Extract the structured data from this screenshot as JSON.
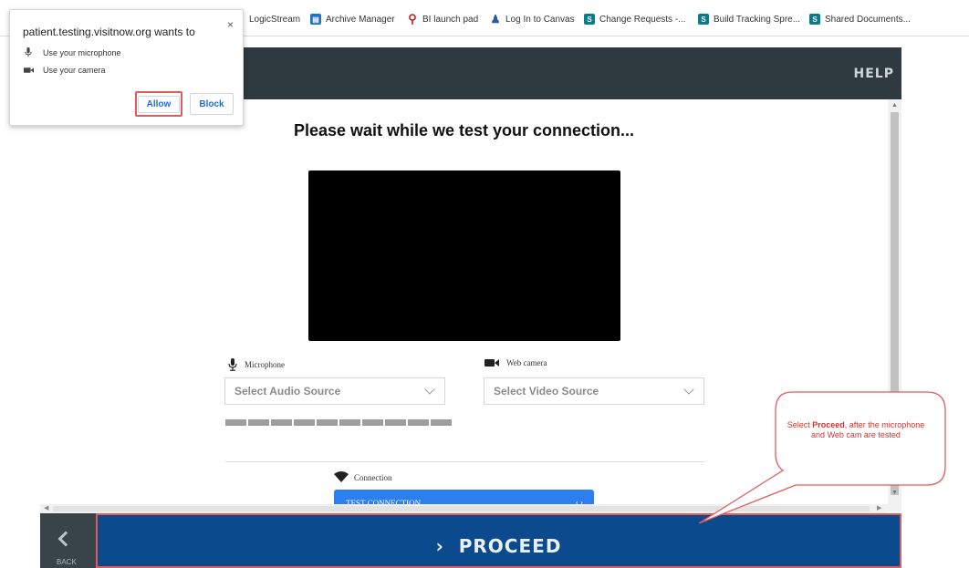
{
  "bookmarks": [
    {
      "label": "LogicStream",
      "icon": "none"
    },
    {
      "label": "Archive Manager",
      "icon": "archive-icon"
    },
    {
      "label": "BI launch pad",
      "icon": "pin-icon"
    },
    {
      "label": "Log In to Canvas",
      "icon": "canvas-icon"
    },
    {
      "label": "Change Requests -...",
      "icon": "sharepoint-icon"
    },
    {
      "label": "Build Tracking Spre...",
      "icon": "sharepoint-icon"
    },
    {
      "label": "Shared Documents...",
      "icon": "sharepoint-icon"
    }
  ],
  "permission_popup": {
    "title": "patient.testing.visitnow.org wants to",
    "close": "×",
    "microphone": "Use your microphone",
    "camera": "Use your camera",
    "allow": "Allow",
    "block": "Block"
  },
  "header": {
    "help": "HELP"
  },
  "main": {
    "title": "Please wait while we test your connection...",
    "microphone_label": "Microphone",
    "audio_select": "Select Audio Source",
    "webcam_label": "Web camera",
    "video_select": "Select Video Source",
    "audio_level": 1.0,
    "connection_label": "Connection",
    "test_connection": "TEST CONNECTION"
  },
  "footer": {
    "back": "BACK",
    "proceed": "PROCEED",
    "proceed_icon": "›"
  },
  "callout": {
    "prefix": "Select ",
    "bold": "Proceed",
    "suffix": ", after the microphone and Web cam are tested"
  },
  "colors": {
    "header": "#2f3a40",
    "proceed": "#0b4a8c",
    "annotation": "#e35a5a"
  }
}
